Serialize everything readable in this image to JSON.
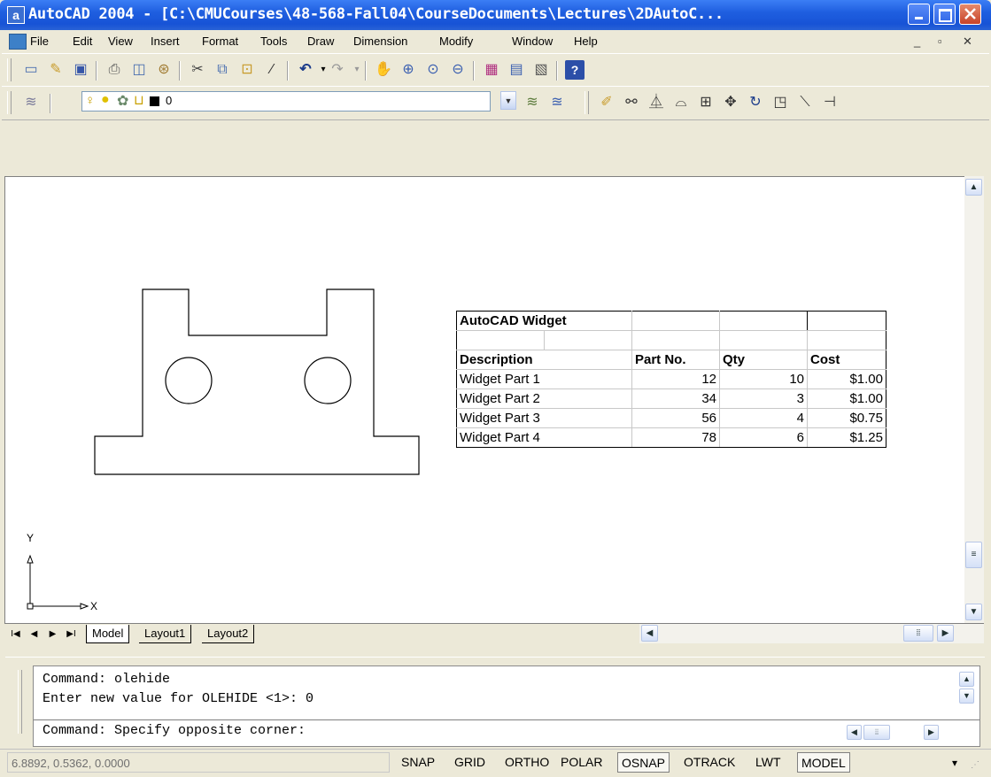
{
  "window": {
    "title": "AutoCAD 2004 - [C:\\CMUCourses\\48-568-Fall04\\CourseDocuments\\Lectures\\2DAutoC...",
    "app_icon_letter": "a"
  },
  "menu": [
    "File",
    "Edit",
    "View",
    "Insert",
    "Format",
    "Tools",
    "Draw",
    "Dimension",
    "Modify",
    "Window",
    "Help"
  ],
  "layer": {
    "current": "0"
  },
  "table": {
    "title": "AutoCAD Widget",
    "headers": [
      "Description",
      "Part No.",
      "Qty",
      "Cost"
    ],
    "rows": [
      [
        "Widget Part 1",
        "12",
        "10",
        "$1.00"
      ],
      [
        "Widget Part 2",
        "34",
        "3",
        "$1.00"
      ],
      [
        "Widget Part 3",
        "56",
        "4",
        "$0.75"
      ],
      [
        "Widget Part 4",
        "78",
        "6",
        "$1.25"
      ]
    ]
  },
  "ucs": {
    "y_label": "Y",
    "x_label": "X"
  },
  "tabs": [
    "Model",
    "Layout1",
    "Layout2"
  ],
  "active_tab": "Model",
  "command": {
    "lines": [
      "Command: olehide",
      "Enter new value for OLEHIDE <1>: 0",
      "Command: Specify opposite corner:"
    ]
  },
  "status": {
    "coords": "6.8892, 0.5362, 0.0000",
    "buttons": [
      {
        "label": "SNAP",
        "on": false
      },
      {
        "label": "GRID",
        "on": false
      },
      {
        "label": "ORTHO",
        "on": false
      },
      {
        "label": "POLAR",
        "on": false
      },
      {
        "label": "OSNAP",
        "on": true
      },
      {
        "label": "OTRACK",
        "on": false
      },
      {
        "label": "LWT",
        "on": false
      },
      {
        "label": "MODEL",
        "on": true
      }
    ]
  },
  "colors": {
    "title_bar": "#1f5fe0",
    "chrome": "#ece9d8",
    "canvas": "#ffffff"
  }
}
